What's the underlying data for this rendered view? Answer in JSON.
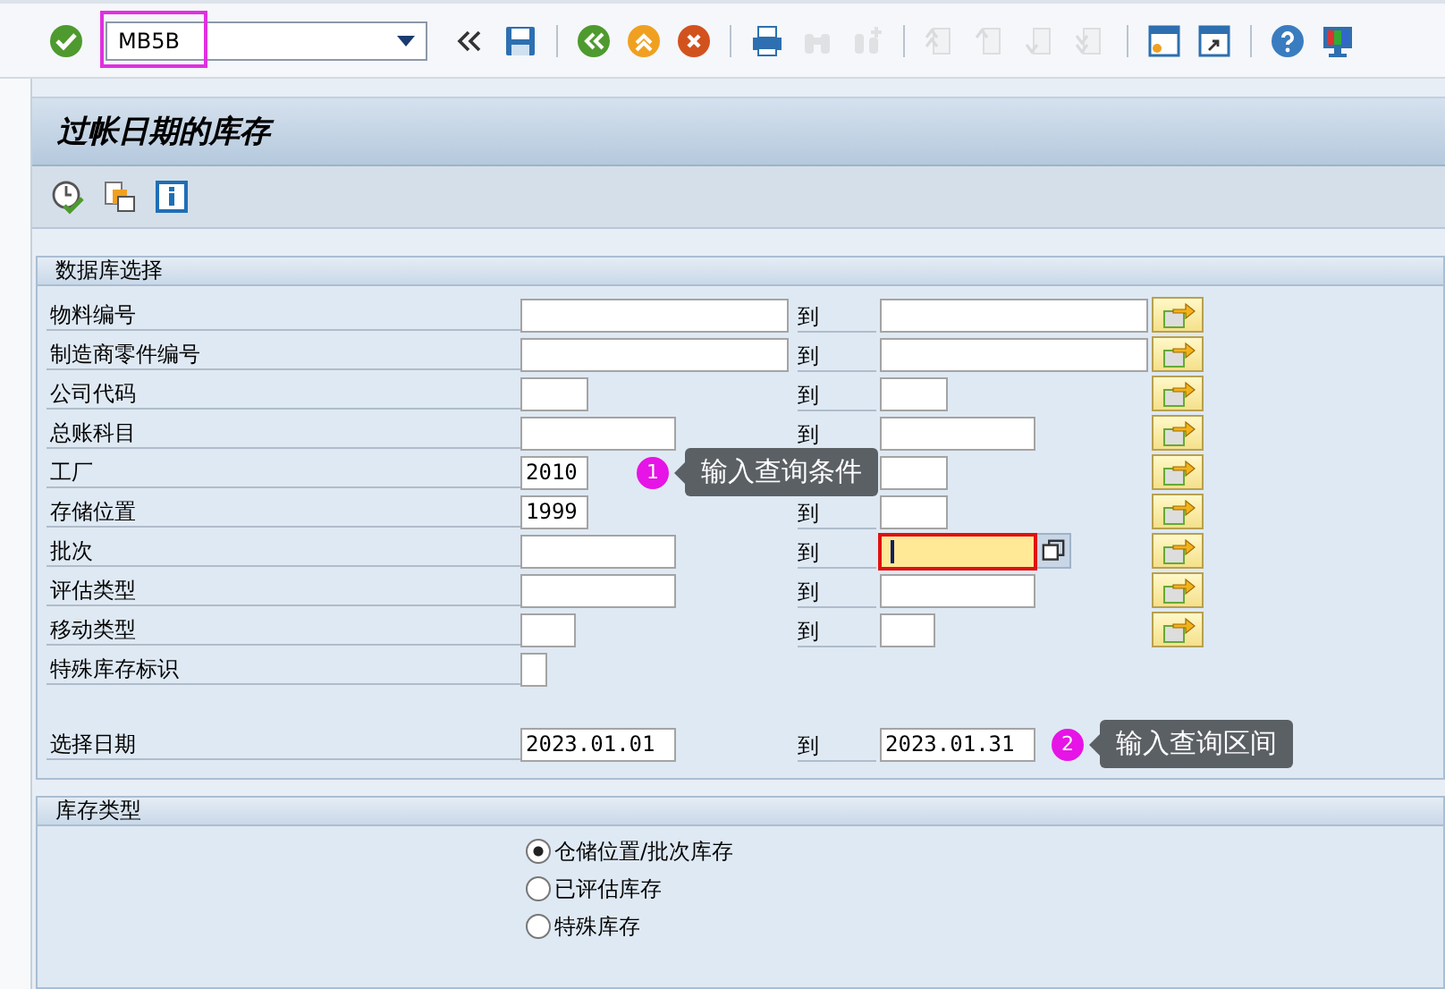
{
  "toolbar": {
    "items": [
      {
        "kind": "enter",
        "disabled": false
      },
      {
        "kind": "command",
        "value": "MB5B",
        "highlighted": true
      },
      {
        "kind": "collapse",
        "disabled": false
      },
      {
        "kind": "save",
        "disabled": false
      },
      {
        "kind": "sep"
      },
      {
        "kind": "back",
        "disabled": false
      },
      {
        "kind": "exit",
        "disabled": false
      },
      {
        "kind": "cancel",
        "disabled": false
      },
      {
        "kind": "sep"
      },
      {
        "kind": "print",
        "disabled": false
      },
      {
        "kind": "find",
        "disabled": true
      },
      {
        "kind": "find-next",
        "disabled": true
      },
      {
        "kind": "sep"
      },
      {
        "kind": "first-page",
        "disabled": true
      },
      {
        "kind": "prev-page",
        "disabled": true
      },
      {
        "kind": "next-page",
        "disabled": true
      },
      {
        "kind": "last-page",
        "disabled": true
      },
      {
        "kind": "sep"
      },
      {
        "kind": "new-session",
        "disabled": false
      },
      {
        "kind": "shortcut",
        "disabled": false
      },
      {
        "kind": "sep"
      },
      {
        "kind": "help",
        "disabled": false
      },
      {
        "kind": "layout",
        "disabled": false
      }
    ]
  },
  "title": "过帐日期的库存",
  "app_toolbar": [
    {
      "kind": "execute"
    },
    {
      "kind": "variants"
    },
    {
      "kind": "info"
    }
  ],
  "database_selection": {
    "title": "数据库选择",
    "rows": [
      {
        "label": "物料编号",
        "to": "到",
        "high_focused": false
      },
      {
        "label": "制造商零件编号",
        "to": "到",
        "high_focused": false
      },
      {
        "label": "公司代码",
        "to": "到",
        "high_focused": false
      },
      {
        "label": "总账科目",
        "to": "到",
        "high_focused": false
      },
      {
        "label": "工厂",
        "low": "2010",
        "high_focused": false,
        "callout": {
          "number": "1",
          "text": "输入查询条件"
        }
      },
      {
        "label": "存储位置",
        "low": "1999",
        "to": "到",
        "high_focused": false
      },
      {
        "label": "批次",
        "to": "到",
        "high_focused": true
      },
      {
        "label": "评估类型",
        "to": "到",
        "high_focused": false
      },
      {
        "label": "移动类型",
        "to": "到",
        "high_focused": false
      },
      {
        "label": "特殊库存标识"
      },
      {
        "label": "选择日期",
        "low": "2023.01.01",
        "to": "到",
        "high": "2023.01.31",
        "high_focused": false,
        "callout": {
          "number": "2",
          "text": "输入查询区间"
        }
      }
    ]
  },
  "stock_type": {
    "title": "库存类型",
    "options": [
      {
        "label": "仓储位置/批次库存",
        "selected": true
      },
      {
        "label": "已评估库存",
        "selected": false
      },
      {
        "label": "特殊库存",
        "selected": false
      }
    ]
  }
}
